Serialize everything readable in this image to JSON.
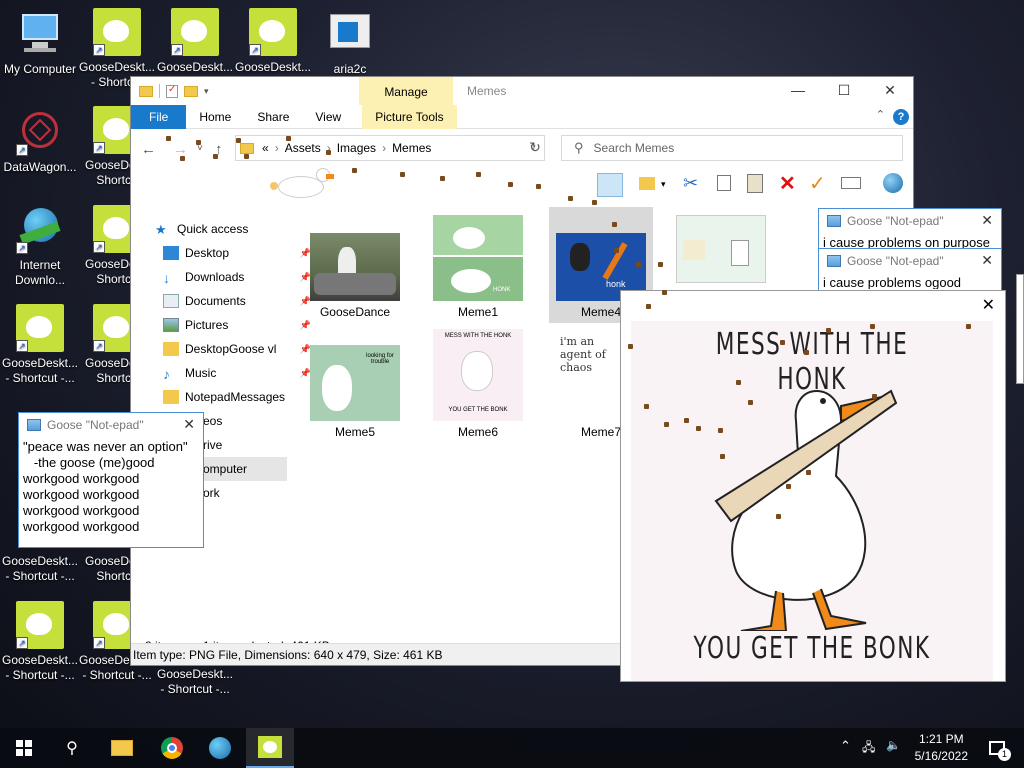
{
  "desktop": {
    "icons": [
      {
        "label": "My Computer"
      },
      {
        "label": "GooseDeskt... - Shortcut"
      },
      {
        "label": "GooseDeskt..."
      },
      {
        "label": "GooseDeskt..."
      },
      {
        "label": "aria2c"
      },
      {
        "label": "DataWagon..."
      },
      {
        "label": "GooseDes - Shortcu"
      },
      {
        "label": "Internet Downlo..."
      },
      {
        "label": "GooseDes - Shortcu"
      },
      {
        "label": "GooseDeskt... - Shortcut -..."
      },
      {
        "label": "GooseDes - Shortcu"
      },
      {
        "label": "GooseDeskt... - Shortcut -..."
      },
      {
        "label": "GooseDes - Shortcu"
      },
      {
        "label": "GooseDeskt... - Shortcut -..."
      },
      {
        "label": "GooseDeskt... - Shortcut -..."
      },
      {
        "label": "GooseDeskt... - Shortcut -..."
      }
    ]
  },
  "explorer": {
    "title": "Memes",
    "manage_tab": "Manage",
    "ribbon_tabs": [
      "File",
      "Home",
      "Share",
      "View",
      "Picture Tools"
    ],
    "breadcrumb": [
      "«",
      "Assets",
      "Images",
      "Memes"
    ],
    "search_placeholder": "Search Memes",
    "nav": [
      {
        "label": "Quick access"
      },
      {
        "label": "Desktop"
      },
      {
        "label": "Downloads"
      },
      {
        "label": "Documents"
      },
      {
        "label": "Pictures"
      },
      {
        "label": "DesktopGoose vl"
      },
      {
        "label": "Music"
      },
      {
        "label": "NotepadMessages"
      },
      {
        "label": "eos"
      },
      {
        "label": "rive"
      },
      {
        "label": "omputer"
      },
      {
        "label": "ork"
      }
    ],
    "files": [
      {
        "name": "GooseDance"
      },
      {
        "name": "Meme1"
      },
      {
        "name": "Meme4"
      },
      {
        "name": "Meme5"
      },
      {
        "name": "Meme6"
      },
      {
        "name": "Meme7"
      }
    ],
    "status_count": "8 items",
    "status_selected": "1 item selected  461 KB",
    "info": "Item type: PNG File, Dimensions: 640 x 479, Size: 461 KB"
  },
  "notepad_left": {
    "title": "Goose \"Not-epad\"",
    "text": "\"peace was never an option\"\n   -the goose (me)good\nworkgood workgood\nworkgood workgood\nworkgood workgood\nworkgood workgood"
  },
  "notepad_r1": {
    "title": "Goose \"Not-epad\"",
    "text": "i cause problems on purpose"
  },
  "notepad_r2": {
    "title": "Goose \"Not-epad\"",
    "text": "i cause problems ogood"
  },
  "viewer": {
    "top_text": "MESS WITH THE HONK",
    "bottom_text": "YOU GET THE BONK"
  },
  "thumbs_text": {
    "meme6_top": "MESS WITH THE HONK",
    "meme6_bottom": "YOU GET THE BONK",
    "meme7": "i'm an agent of chaos",
    "meme1": "HONK",
    "meme5": "looking for trouble"
  },
  "taskbar": {
    "time": "1:21 PM",
    "date": "5/16/2022",
    "notif_count": "1"
  }
}
